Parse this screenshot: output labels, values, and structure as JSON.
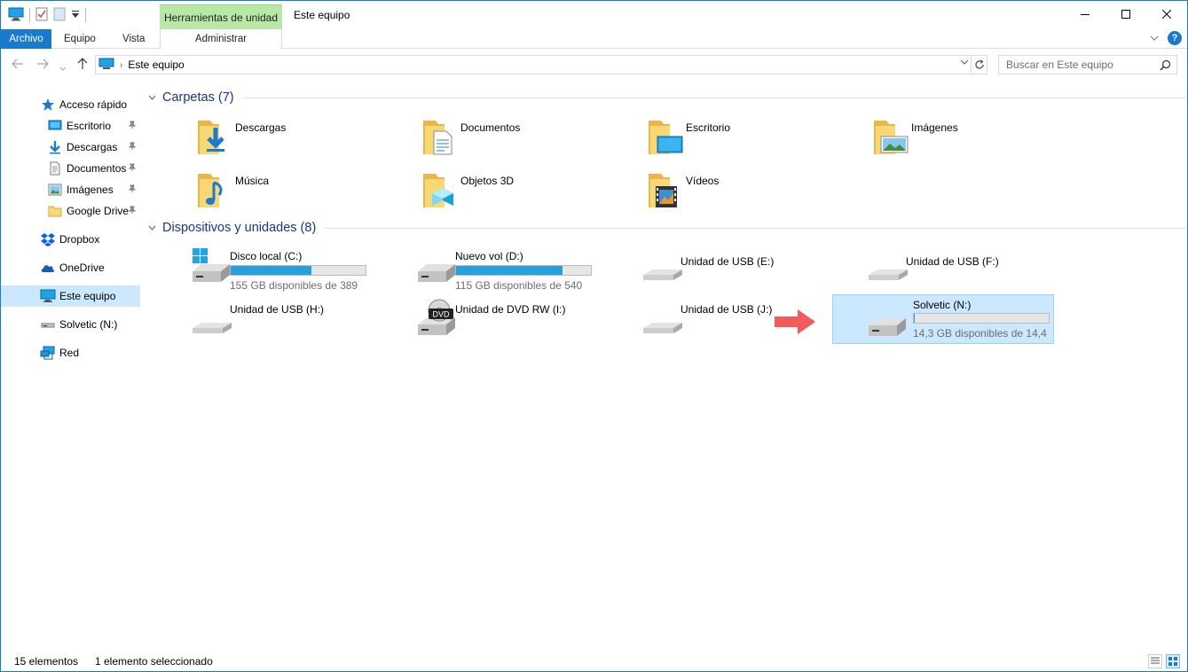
{
  "window": {
    "title": "Este equipo",
    "context_tab_header": "Herramientas de unidad"
  },
  "ribbon": {
    "tabs": [
      {
        "label": "Archivo"
      },
      {
        "label": "Equipo"
      },
      {
        "label": "Vista"
      },
      {
        "label": "Administrar"
      }
    ]
  },
  "navbar": {
    "address": "Este equipo",
    "search_placeholder": "Buscar en Este equipo"
  },
  "sidebar": {
    "items": [
      {
        "label": "Acceso rápido",
        "icon": "star-icon",
        "pinned": false
      },
      {
        "label": "Escritorio",
        "icon": "desktop-icon",
        "pinned": true
      },
      {
        "label": "Descargas",
        "icon": "download-icon",
        "pinned": true
      },
      {
        "label": "Documentos",
        "icon": "document-icon",
        "pinned": true
      },
      {
        "label": "Imágenes",
        "icon": "image-icon",
        "pinned": true
      },
      {
        "label": "Google Drive",
        "icon": "folder-icon",
        "pinned": true
      },
      {
        "label": "Dropbox",
        "icon": "dropbox-icon",
        "pinned": false
      },
      {
        "label": "OneDrive",
        "icon": "cloud-icon",
        "pinned": false
      },
      {
        "label": "Este equipo",
        "icon": "computer-icon",
        "pinned": false,
        "selected": true
      },
      {
        "label": "Solvetic (N:)",
        "icon": "usb-drive-icon",
        "pinned": false
      },
      {
        "label": "Red",
        "icon": "network-icon",
        "pinned": false
      }
    ]
  },
  "folders": {
    "header": "Carpetas (7)",
    "items": [
      {
        "name": "Descargas",
        "icon": "downloads-folder-icon"
      },
      {
        "name": "Documentos",
        "icon": "documents-folder-icon"
      },
      {
        "name": "Escritorio",
        "icon": "desktop-folder-icon"
      },
      {
        "name": "Imágenes",
        "icon": "pictures-folder-icon"
      },
      {
        "name": "Música",
        "icon": "music-folder-icon"
      },
      {
        "name": "Objetos 3D",
        "icon": "3d-objects-folder-icon"
      },
      {
        "name": "Vídeos",
        "icon": "videos-folder-icon"
      }
    ]
  },
  "devices": {
    "header": "Dispositivos y unidades (8)",
    "items": [
      {
        "name": "Disco local (C:)",
        "free": "155 GB disponibles de 389",
        "used_fraction": 0.6,
        "icon": "windows-drive-icon"
      },
      {
        "name": "Nuevo vol (D:)",
        "free": "115 GB disponibles de 540",
        "used_fraction": 0.79,
        "icon": "hard-drive-icon"
      },
      {
        "name": "Unidad de USB (E:)",
        "icon": "usb-drive-icon"
      },
      {
        "name": "Unidad de USB (F:)",
        "icon": "usb-drive-icon"
      },
      {
        "name": "Unidad de USB (H:)",
        "icon": "usb-drive-icon"
      },
      {
        "name": "Unidad de DVD RW (I:)",
        "icon": "dvd-drive-icon",
        "badge": "DVD"
      },
      {
        "name": "Unidad de USB (J:)",
        "icon": "usb-drive-icon"
      },
      {
        "name": "Solvetic (N:)",
        "free": "14,3 GB disponibles de 14,4",
        "used_fraction": 0.007,
        "icon": "hard-drive-icon",
        "selected": true
      }
    ]
  },
  "status": {
    "count": "15 elementos",
    "selection": "1 elemento seleccionado"
  },
  "colors": {
    "accent": "#1979ca",
    "selection": "#cce8ff",
    "context_tab": "#b8e8a8",
    "group_title": "#1e3287",
    "bar_fill": "#26a0da",
    "annotation_arrow": "#f25b5b"
  }
}
